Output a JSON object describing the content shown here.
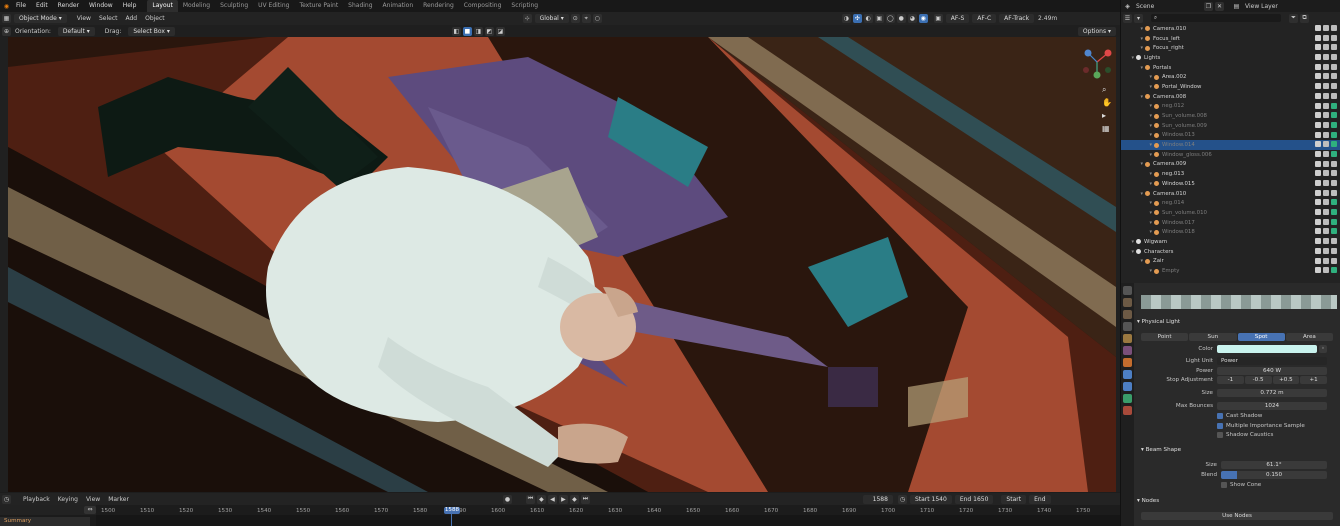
{
  "topbar": {
    "menus": [
      "File",
      "Edit",
      "Render",
      "Window",
      "Help"
    ],
    "workspaces": [
      "Layout",
      "Modeling",
      "Sculpting",
      "UV Editing",
      "Texture Paint",
      "Shading",
      "Animation",
      "Rendering",
      "Compositing",
      "Scripting"
    ],
    "active_workspace": "Layout",
    "scene": "Scene",
    "view_layer": "View Layer"
  },
  "viewport_header": {
    "mode": "Object Mode",
    "menus": [
      "View",
      "Select",
      "Add",
      "Object"
    ],
    "transform": "Global",
    "af_s": "AF-S",
    "af_c": "AF-C",
    "af_track": "AF-Track",
    "focal": "2.49m"
  },
  "tool_header": {
    "orientation_label": "Orientation:",
    "orientation_value": "Default",
    "drag_label": "Drag:",
    "drag_value": "Select Box",
    "options": "Options"
  },
  "outliner": {
    "rows": [
      {
        "name": "Camera.010",
        "indent": 2,
        "dim": false,
        "selected": false
      },
      {
        "name": "Focus_left",
        "indent": 2,
        "dim": false,
        "selected": false
      },
      {
        "name": "Focus_right",
        "indent": 2,
        "dim": false,
        "selected": false
      },
      {
        "name": "Lights",
        "indent": 1,
        "dim": false,
        "selected": false
      },
      {
        "name": "Portals",
        "indent": 2,
        "dim": false,
        "selected": false
      },
      {
        "name": "Area.002",
        "indent": 3,
        "dim": false,
        "selected": false
      },
      {
        "name": "Portal_Window",
        "indent": 3,
        "dim": false,
        "selected": false
      },
      {
        "name": "Camera.008",
        "indent": 2,
        "dim": false,
        "selected": false
      },
      {
        "name": "neg.012",
        "indent": 3,
        "dim": true,
        "selected": false
      },
      {
        "name": "Sun_volume.008",
        "indent": 3,
        "dim": true,
        "selected": false
      },
      {
        "name": "Sun_volume.009",
        "indent": 3,
        "dim": true,
        "selected": false
      },
      {
        "name": "Window.013",
        "indent": 3,
        "dim": true,
        "selected": false
      },
      {
        "name": "Window.014",
        "indent": 3,
        "dim": true,
        "selected": true
      },
      {
        "name": "Window_gloss.006",
        "indent": 3,
        "dim": true,
        "selected": false
      },
      {
        "name": "Camera.009",
        "indent": 2,
        "dim": false,
        "selected": false
      },
      {
        "name": "neg.013",
        "indent": 3,
        "dim": false,
        "selected": false
      },
      {
        "name": "Window.015",
        "indent": 3,
        "dim": false,
        "selected": false
      },
      {
        "name": "Camera.010",
        "indent": 2,
        "dim": false,
        "selected": false
      },
      {
        "name": "neg.014",
        "indent": 3,
        "dim": true,
        "selected": false
      },
      {
        "name": "Sun_volume.010",
        "indent": 3,
        "dim": true,
        "selected": false
      },
      {
        "name": "Window.017",
        "indent": 3,
        "dim": true,
        "selected": false
      },
      {
        "name": "Window.018",
        "indent": 3,
        "dim": true,
        "selected": false
      },
      {
        "name": "Wigwam",
        "indent": 1,
        "dim": false,
        "selected": false
      },
      {
        "name": "Characters",
        "indent": 1,
        "dim": false,
        "selected": false
      },
      {
        "name": "Zair",
        "indent": 2,
        "dim": false,
        "selected": false
      },
      {
        "name": "Empty",
        "indent": 3,
        "dim": true,
        "selected": false
      }
    ]
  },
  "properties": {
    "panel_title": "Physical Light",
    "light_types": [
      "Point",
      "Sun",
      "Spot",
      "Area"
    ],
    "active_type": "Spot",
    "color_label": "Color",
    "color_value": "#c9f3ee",
    "light_unit_label": "Light Unit",
    "light_unit_value": "Power",
    "power_label": "Power",
    "power_value": "640 W",
    "stop_label": "Stop Adjustment",
    "stop_buttons": [
      "-1",
      "-0.5",
      "+0.5",
      "+1"
    ],
    "size_label": "Size",
    "size_value": "0.772 m",
    "bounces_label": "Max Bounces",
    "bounces_value": "1024",
    "cast_shadow": "Cast Shadow",
    "mis": "Multiple Importance Sample",
    "caustics": "Shadow Caustics",
    "beam_title": "Beam Shape",
    "beam_size_label": "Size",
    "beam_size_value": "61.1°",
    "blend_label": "Blend",
    "blend_value": "0.150",
    "blend_fraction": 0.15,
    "show_cone": "Show Cone",
    "nodes_title": "Nodes",
    "use_nodes": "Use Nodes"
  },
  "timeline": {
    "menus": [
      "Playback",
      "Keying",
      "View",
      "Marker"
    ],
    "current_frame": "1588",
    "start_label": "Start",
    "start_value": "1540",
    "end_label": "End",
    "end_value": "1650",
    "start_btn": "Start",
    "end_btn": "End",
    "ticks": [
      "1500",
      "1510",
      "1520",
      "1530",
      "1540",
      "1550",
      "1560",
      "1570",
      "1580",
      "1590",
      "1600",
      "1610",
      "1620",
      "1630",
      "1640",
      "1650",
      "1660",
      "1670",
      "1680",
      "1690",
      "1700",
      "1710",
      "1720",
      "1730",
      "1740",
      "1750"
    ],
    "summary": "Summary",
    "playhead_label": "1588"
  },
  "colors": {
    "accent": "#4772b3",
    "selected": "#24518a",
    "green": "#2fb07e"
  }
}
